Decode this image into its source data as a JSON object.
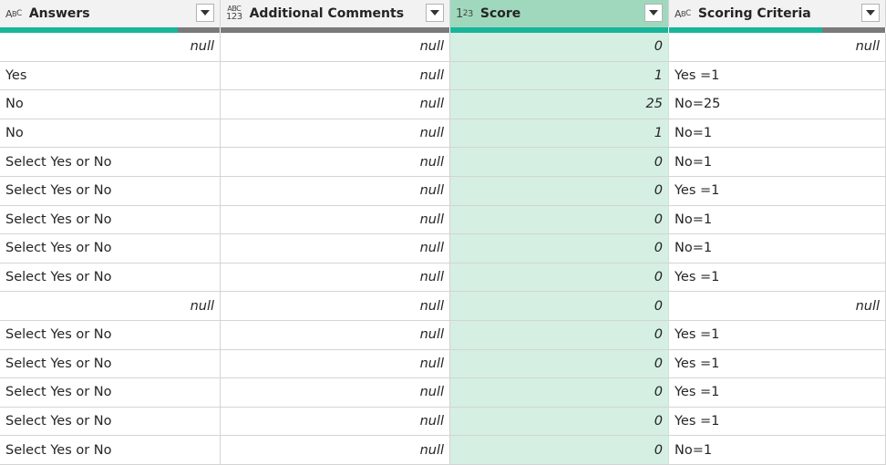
{
  "columns": [
    {
      "label": "Answers",
      "type_icon": "ABC",
      "type_name": "text-type-icon"
    },
    {
      "label": "Additional Comments",
      "type_icon": "ABC/123",
      "type_name": "any-type-icon"
    },
    {
      "label": "Score",
      "type_icon": "123",
      "type_name": "number-type-icon"
    },
    {
      "label": "Scoring Criteria",
      "type_icon": "ABC",
      "type_name": "text-type-icon"
    }
  ],
  "quality": [
    {
      "valid": 0.81,
      "empty": 0.19
    },
    {
      "valid": 0.0,
      "empty": 1.0
    },
    {
      "valid": 1.0,
      "empty": 0.0
    },
    {
      "valid": 0.71,
      "empty": 0.29
    }
  ],
  "colors": {
    "selected_header": "#9fd8bd",
    "selected_cells": "#d5efe2",
    "valid_bar": "#18b59a",
    "empty_bar": "#7a7a7a"
  },
  "rows": [
    {
      "answers": "null",
      "comments": "null",
      "score": "0",
      "criteria": "null"
    },
    {
      "answers": "Yes",
      "comments": "null",
      "score": "1",
      "criteria": "Yes =1"
    },
    {
      "answers": "No",
      "comments": "null",
      "score": "25",
      "criteria": "No=25"
    },
    {
      "answers": "No",
      "comments": "null",
      "score": "1",
      "criteria": "No=1"
    },
    {
      "answers": "Select Yes or No",
      "comments": "null",
      "score": "0",
      "criteria": "No=1"
    },
    {
      "answers": "Select Yes or No",
      "comments": "null",
      "score": "0",
      "criteria": "Yes =1"
    },
    {
      "answers": "Select Yes or No",
      "comments": "null",
      "score": "0",
      "criteria": "No=1"
    },
    {
      "answers": "Select Yes or No",
      "comments": "null",
      "score": "0",
      "criteria": "No=1"
    },
    {
      "answers": "Select Yes or No",
      "comments": "null",
      "score": "0",
      "criteria": "Yes =1"
    },
    {
      "answers": "null",
      "comments": "null",
      "score": "0",
      "criteria": "null"
    },
    {
      "answers": "Select Yes or No",
      "comments": "null",
      "score": "0",
      "criteria": "Yes =1"
    },
    {
      "answers": "Select Yes or No",
      "comments": "null",
      "score": "0",
      "criteria": "Yes =1"
    },
    {
      "answers": "Select Yes or No",
      "comments": "null",
      "score": "0",
      "criteria": "Yes =1"
    },
    {
      "answers": "Select Yes or No",
      "comments": "null",
      "score": "0",
      "criteria": "Yes =1"
    },
    {
      "answers": "Select Yes or No",
      "comments": "null",
      "score": "0",
      "criteria": "No=1"
    }
  ]
}
